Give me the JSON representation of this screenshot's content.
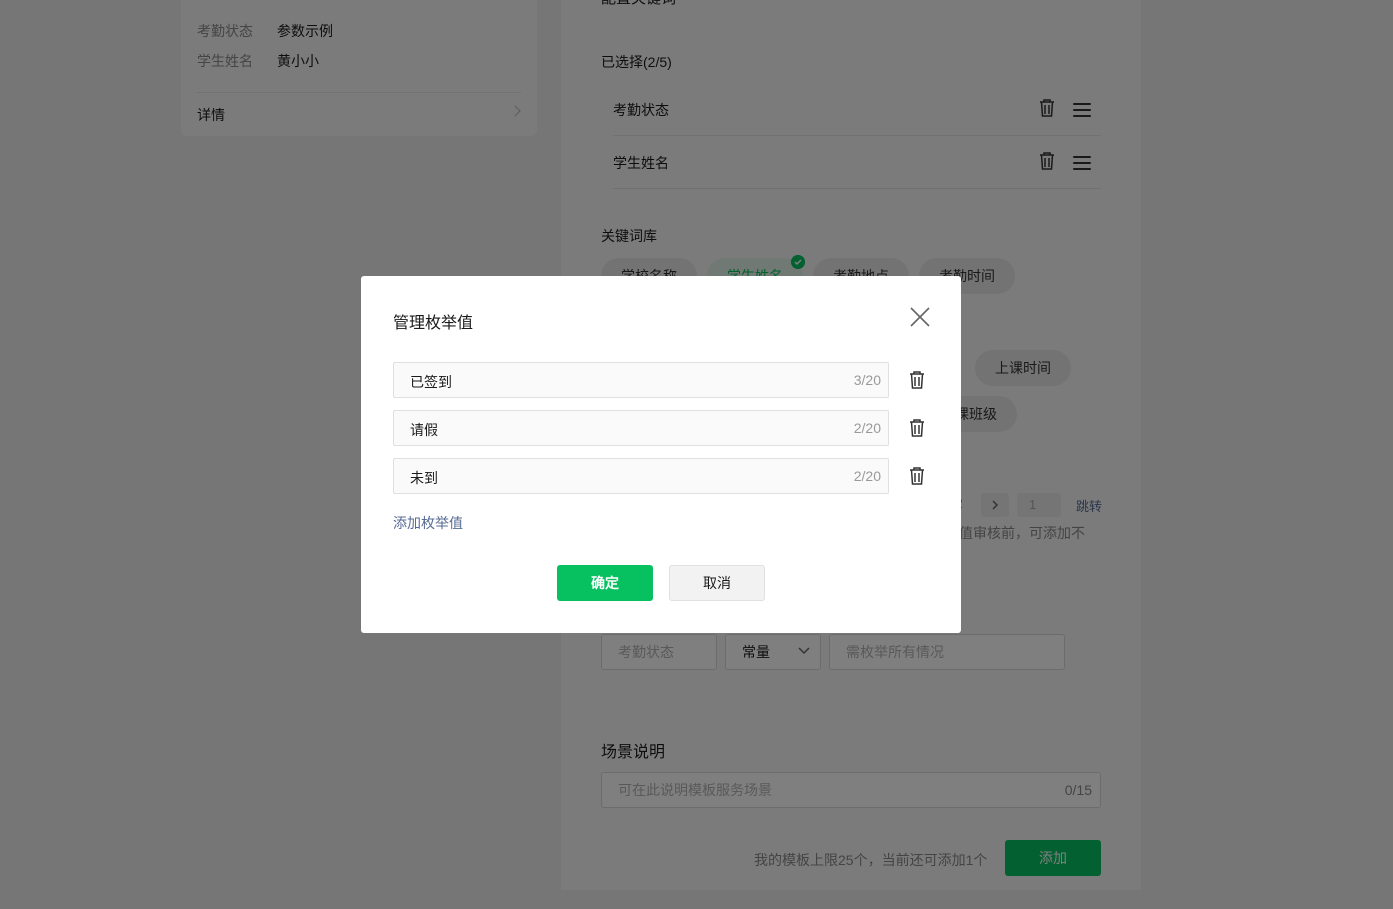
{
  "preview": {
    "rows": [
      {
        "key": "考勤状态",
        "value": "参数示例"
      },
      {
        "key": "学生姓名",
        "value": "黄小小"
      }
    ],
    "detail_label": "详情"
  },
  "form": {
    "keywords_title": "配置关键词",
    "selected_label": "已选择(2/5)",
    "selected_items": [
      "考勤状态",
      "学生姓名"
    ],
    "library_title": "关键词库",
    "library_chips_row1": [
      "学校名称",
      "学生姓名",
      "考勤地点",
      "考勤时间"
    ],
    "library_chips_row2_visible": [
      "上课时间"
    ],
    "library_chips_row3_visible": [
      "课班级"
    ],
    "pagination": {
      "page_fragment": "2",
      "jump_input": "1",
      "jump_label": "跳转"
    },
    "hint_fragment": "值审核前，可添加不",
    "param_row": {
      "name_placeholder": "考勤状态",
      "type_value": "常量",
      "desc_placeholder": "需枚举所有情况"
    },
    "scene_title": "场景说明",
    "scene_placeholder": "可在此说明模板服务场景",
    "scene_count": "0/15",
    "quota_text": "我的模板上限25个，当前还可添加1个",
    "add_button": "添加"
  },
  "dialog": {
    "title": "管理枚举值",
    "enum_values": [
      {
        "value": "已签到",
        "count": "3/20"
      },
      {
        "value": "请假",
        "count": "2/20"
      },
      {
        "value": "未到",
        "count": "2/20"
      }
    ],
    "add_link": "添加枚举值",
    "confirm_button": "确定",
    "cancel_button": "取消"
  },
  "colors": {
    "accent": "#07c160",
    "link": "#576b95",
    "mask": "rgba(0,0,0,0.5)"
  }
}
